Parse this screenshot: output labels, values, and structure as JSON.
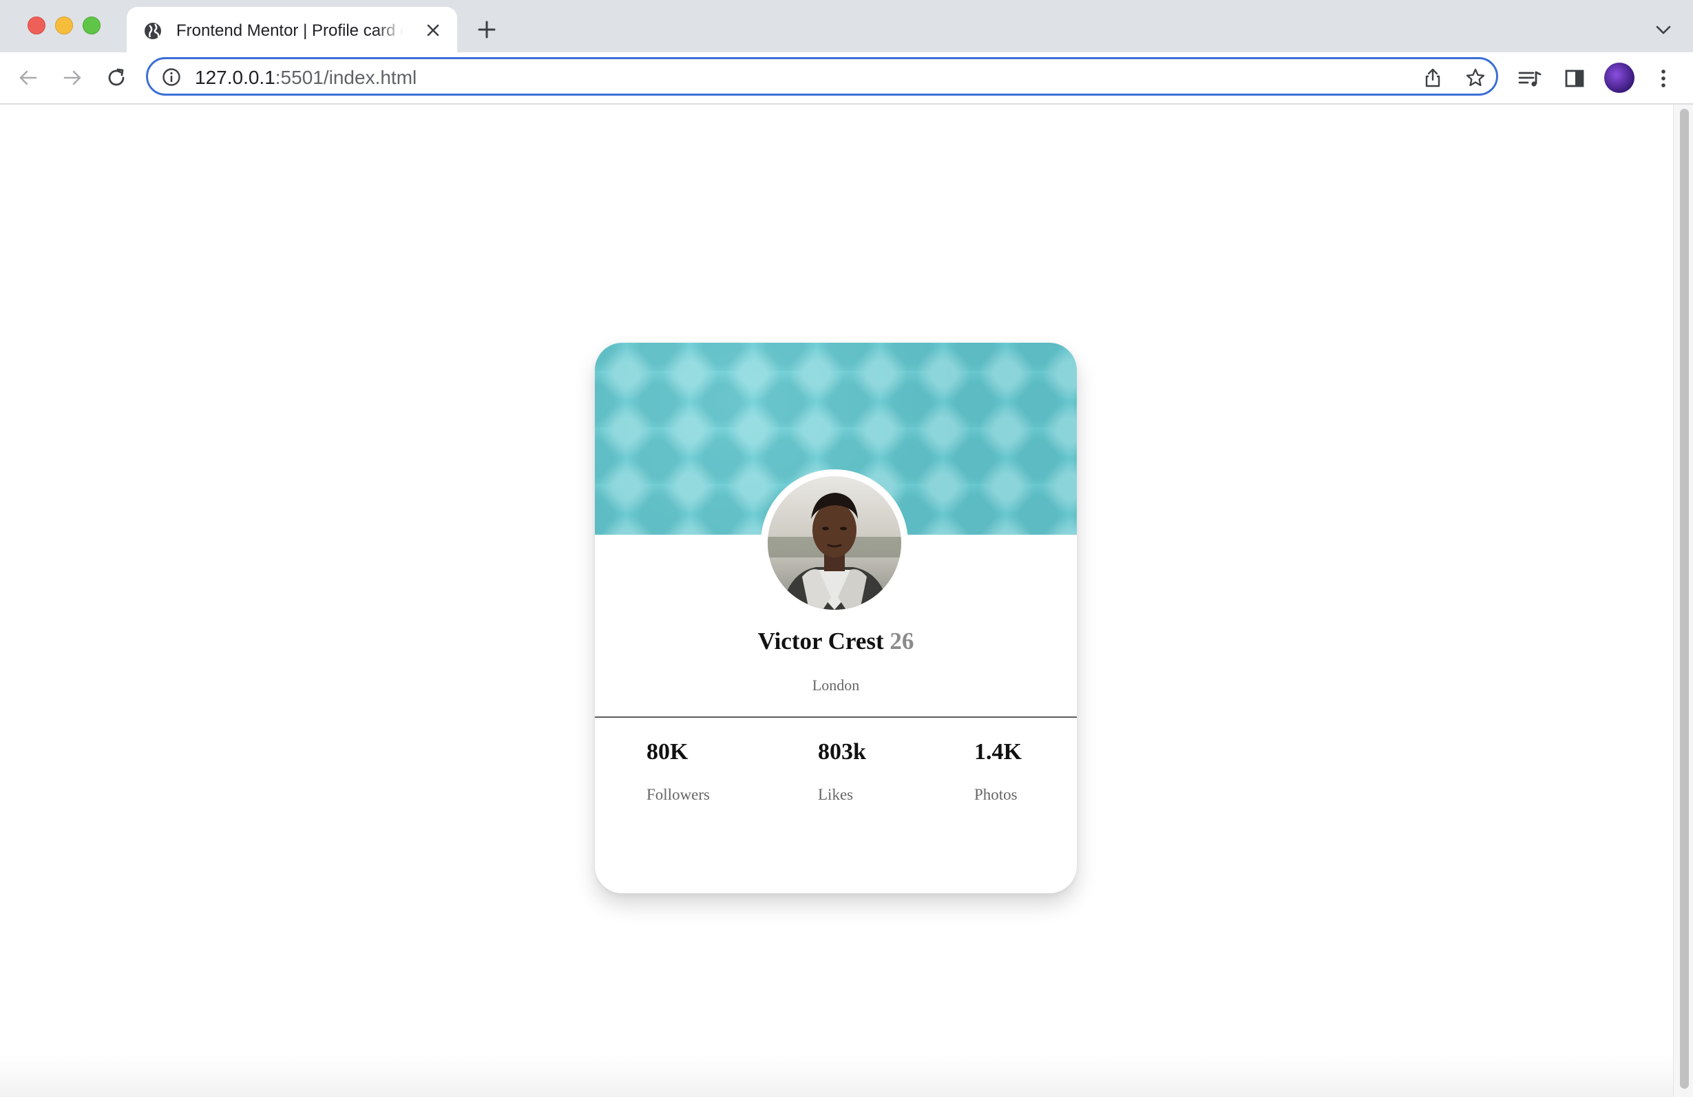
{
  "browser": {
    "tab_title": "Frontend Mentor | Profile card component",
    "url_host": "127.0.0.1",
    "url_rest": ":5501/index.html"
  },
  "icons": {
    "favicon": "globe-icon",
    "tab_close": "close-icon",
    "new_tab": "plus-icon",
    "tab_list": "chevron-down-icon",
    "back": "back-arrow-icon",
    "forward": "forward-arrow-icon",
    "reload": "reload-icon",
    "site_info": "info-icon",
    "share": "share-icon",
    "bookmark": "star-icon",
    "reading_list": "reading-list-icon",
    "side_panel": "side-panel-icon",
    "menu": "kebab-menu-icon"
  },
  "colors": {
    "banner": "#6ac8cf",
    "omnibox_focus": "#3b6fd6",
    "age_text": "#8a8a8a"
  },
  "profile": {
    "name": "Victor Crest",
    "age": "26",
    "location": "London",
    "stats": [
      {
        "value": "80K",
        "label": "Followers"
      },
      {
        "value": "803k",
        "label": "Likes"
      },
      {
        "value": "1.4K",
        "label": "Photos"
      }
    ]
  }
}
